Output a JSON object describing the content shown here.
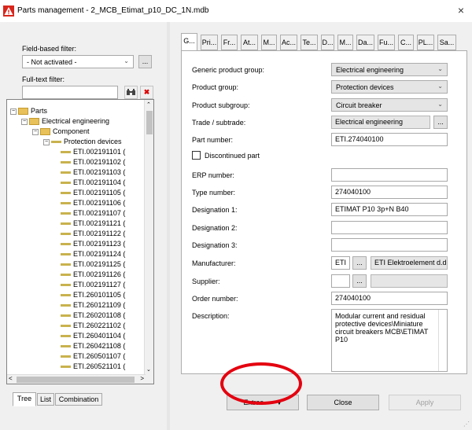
{
  "window": {
    "title": "Parts management - 2_MCB_Etimat_p10_DC_1N.mdb",
    "close_glyph": "×",
    "app_icon": "warning-triangle-icon",
    "accent": "#d9261c"
  },
  "left": {
    "field_filter_label": "Field-based filter:",
    "field_filter_value": "- Not activated -",
    "more_button": "...",
    "fulltext_label": "Full-text filter:",
    "fulltext_value": "",
    "tree": {
      "nodes": [
        {
          "label": "Parts",
          "expander": "−"
        },
        {
          "label": "Electrical engineering",
          "expander": "−"
        },
        {
          "label": "Component",
          "expander": "−"
        },
        {
          "label": "Protection devices",
          "expander": "−"
        }
      ],
      "leaves": [
        "ETI.002191101 (",
        "ETI.002191102 (",
        "ETI.002191103 (",
        "ETI.002191104 (",
        "ETI.002191105 (",
        "ETI.002191106 (",
        "ETI.002191107 (",
        "ETI.002191121 (",
        "ETI.002191122 (",
        "ETI.002191123 (",
        "ETI.002191124 (",
        "ETI.002191125 (",
        "ETI.002191126 (",
        "ETI.002191127 (",
        "ETI.260101105 (",
        "ETI.260121109 (",
        "ETI.260201108 (",
        "ETI.260221102 (",
        "ETI.260401104 (",
        "ETI.260421108 (",
        "ETI.260501107 (",
        "ETI.260521101 ("
      ]
    },
    "bottom_tabs": [
      "Tree",
      "List",
      "Combination"
    ]
  },
  "right": {
    "tabs": [
      "G...",
      "Pri...",
      "Fr...",
      "At...",
      "M...",
      "Ac...",
      "Te...",
      "D...",
      "M...",
      "Da...",
      "Fu...",
      "C...",
      "PL...",
      "Sa..."
    ],
    "fields": {
      "generic_group": {
        "label": "Generic product group:",
        "value": "Electrical engineering"
      },
      "product_group": {
        "label": "Product group:",
        "value": "Protection devices"
      },
      "subgroup": {
        "label": "Product subgroup:",
        "value": "Circuit breaker"
      },
      "trade": {
        "label": "Trade / subtrade:",
        "value": "Electrical engineering"
      },
      "part_number": {
        "label": "Part number:",
        "value": "ETI.274040100"
      },
      "discontinued": {
        "label": "Discontinued part"
      },
      "erp_number": {
        "label": "ERP number:",
        "value": ""
      },
      "type_number": {
        "label": "Type number:",
        "value": "274040100"
      },
      "designation1": {
        "label": "Designation 1:",
        "value": "ETIMAT P10 3p+N B40"
      },
      "designation2": {
        "label": "Designation 2:",
        "value": ""
      },
      "designation3": {
        "label": "Designation 3:",
        "value": ""
      },
      "manufacturer": {
        "label": "Manufacturer:",
        "code": "ETI",
        "name": "ETI Elektroelement d.d"
      },
      "supplier": {
        "label": "Supplier:",
        "code": "",
        "name": ""
      },
      "order_number": {
        "label": "Order number:",
        "value": "274040100"
      },
      "description": {
        "label": "Description:",
        "value": "Modular current and residual protective devices\\Miniature circuit breakers MCB\\ETIMAT P10"
      }
    },
    "buttons": {
      "extras": "Extras",
      "close": "Close",
      "apply": "Apply"
    }
  },
  "highlight_color": "#e4000f"
}
